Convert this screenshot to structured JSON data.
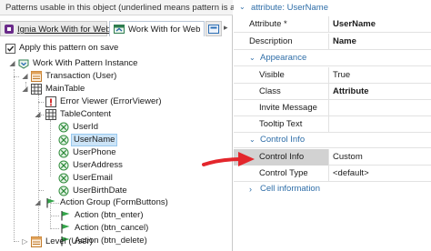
{
  "left_pane": {
    "hint": "Patterns usable in this object (underlined means pattern is applied)",
    "tabs": [
      {
        "label": "Ignia Work With for Web"
      },
      {
        "label": "Work With for Web"
      },
      {
        "label": ""
      }
    ],
    "apply_checkbox": {
      "label": "Apply this pattern on save",
      "checked": true
    },
    "tree": [
      {
        "label": "Work With Pattern Instance",
        "icon": "instance-icon"
      },
      {
        "label": "Transaction (User)",
        "icon": "transaction-icon"
      },
      {
        "label": "MainTable",
        "icon": "table-icon"
      },
      {
        "label": "Error Viewer (ErrorViewer)",
        "icon": "error-viewer-icon"
      },
      {
        "label": "TableContent",
        "icon": "table-icon"
      },
      {
        "label": "UserId",
        "icon": "attribute-icon"
      },
      {
        "label": "UserName",
        "icon": "attribute-icon",
        "selected": true
      },
      {
        "label": "UserPhone",
        "icon": "attribute-icon"
      },
      {
        "label": "UserAddress",
        "icon": "attribute-icon"
      },
      {
        "label": "UserEmail",
        "icon": "attribute-icon"
      },
      {
        "label": "UserBirthDate",
        "icon": "attribute-icon"
      },
      {
        "label": "Action Group (FormButtons)",
        "icon": "flag-icon"
      },
      {
        "label": "Action (btn_enter)",
        "icon": "flag-icon"
      },
      {
        "label": "Action (btn_cancel)",
        "icon": "flag-icon"
      },
      {
        "label": "Action (btn_delete)",
        "icon": "flag-icon"
      },
      {
        "label": "Level (User)",
        "icon": "level-icon"
      }
    ]
  },
  "right_pane": {
    "header": "attribute: UserName",
    "top_props": [
      {
        "key": "Attribute *",
        "value": "UserName"
      },
      {
        "key": "Description",
        "value": "Name"
      }
    ],
    "categories": [
      {
        "title": "Appearance",
        "expanded": true,
        "props": [
          {
            "key": "Visible",
            "value": "True"
          },
          {
            "key": "Class",
            "value": "Attribute"
          },
          {
            "key": "Invite Message",
            "value": ""
          },
          {
            "key": "Tooltip Text",
            "value": ""
          }
        ]
      },
      {
        "title": "Control Info",
        "expanded": true,
        "props": [
          {
            "key": "Control Info",
            "value": "Custom"
          },
          {
            "key": "Control Type",
            "value": "<default>"
          }
        ]
      },
      {
        "title": "Cell information",
        "expanded": false,
        "props": []
      }
    ]
  },
  "colors": {
    "accent_blue": "#2f6ea8",
    "selection": "#cce4f7",
    "pointer_red": "#e3262c",
    "attribute_green": "#2e8b3a"
  }
}
